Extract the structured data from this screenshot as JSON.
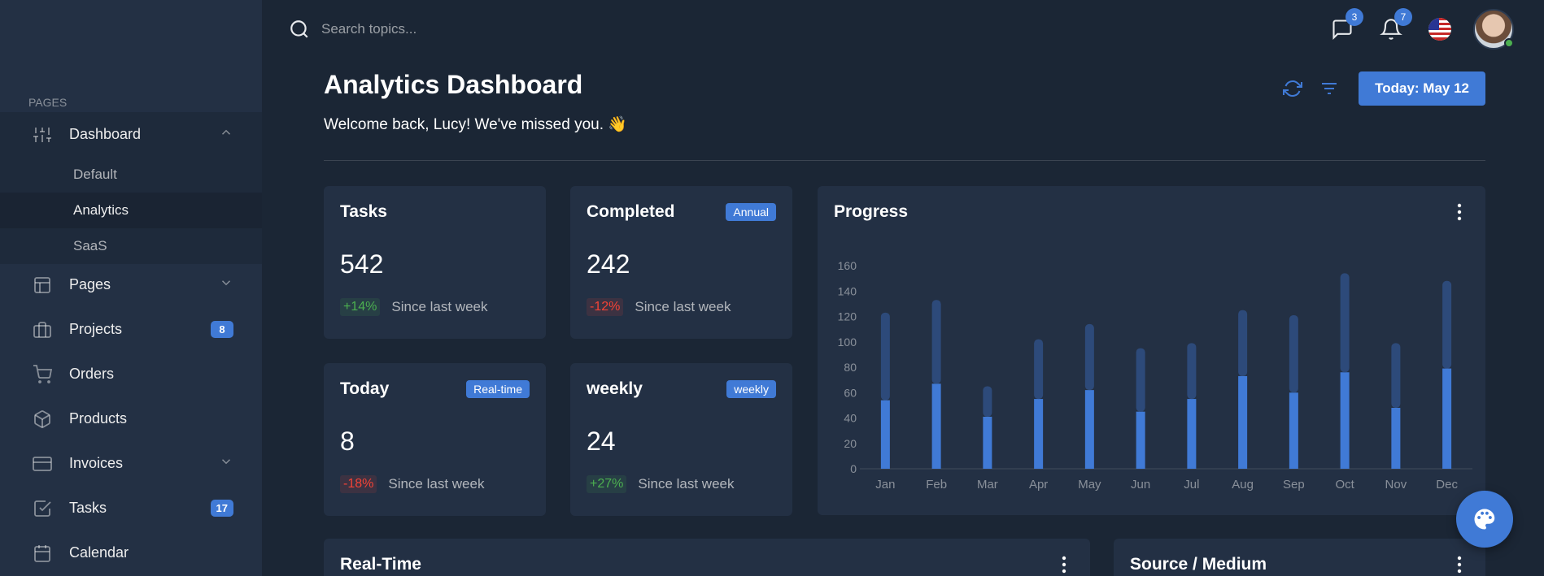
{
  "sidebar": {
    "section_title": "PAGES",
    "dashboard": {
      "label": "Dashboard",
      "icon": "sliders-icon"
    },
    "sub_items": [
      {
        "label": "Default",
        "active": false
      },
      {
        "label": "Analytics",
        "active": true
      },
      {
        "label": "SaaS",
        "active": false
      }
    ],
    "items": [
      {
        "label": "Pages",
        "icon": "layout-icon",
        "chevron": true,
        "badge": ""
      },
      {
        "label": "Projects",
        "icon": "briefcase-icon",
        "chevron": false,
        "badge": "8"
      },
      {
        "label": "Orders",
        "icon": "cart-icon",
        "chevron": false,
        "badge": ""
      },
      {
        "label": "Products",
        "icon": "package-icon",
        "chevron": false,
        "badge": ""
      },
      {
        "label": "Invoices",
        "icon": "card-icon",
        "chevron": true,
        "badge": ""
      },
      {
        "label": "Tasks",
        "icon": "checkbox-icon",
        "chevron": false,
        "badge": "17"
      },
      {
        "label": "Calendar",
        "icon": "calendar-icon",
        "chevron": false,
        "badge": ""
      }
    ]
  },
  "topbar": {
    "search_placeholder": "Search topics...",
    "messages_count": "3",
    "notifications_count": "7"
  },
  "header": {
    "title": "Analytics Dashboard",
    "welcome": "Welcome back, Lucy! We've missed you. 👋",
    "today_button": "Today: May 12"
  },
  "stats": [
    {
      "title": "Tasks",
      "chip": "",
      "value": "542",
      "delta": "+14%",
      "delta_dir": "up",
      "since": "Since last week"
    },
    {
      "title": "Completed",
      "chip": "Annual",
      "value": "242",
      "delta": "-12%",
      "delta_dir": "down",
      "since": "Since last week"
    },
    {
      "title": "Today",
      "chip": "Real-time",
      "value": "8",
      "delta": "-18%",
      "delta_dir": "down",
      "since": "Since last week"
    },
    {
      "title": "weekly",
      "chip": "weekly",
      "value": "24",
      "delta": "+27%",
      "delta_dir": "up",
      "since": "Since last week"
    }
  ],
  "progress": {
    "title": "Progress"
  },
  "bottom_cards": {
    "realtime_title": "Real-Time",
    "source_title": "Source / Medium"
  },
  "colors": {
    "accent": "#407ad6",
    "bar_light": "#407ad6",
    "bar_dark": "#2d4a7a",
    "sidebar": "#233044",
    "background": "#1b2635"
  },
  "chart_data": {
    "type": "bar",
    "stacked": true,
    "categories": [
      "Jan",
      "Feb",
      "Mar",
      "Apr",
      "May",
      "Jun",
      "Jul",
      "Aug",
      "Sep",
      "Oct",
      "Nov",
      "Dec"
    ],
    "series": [
      {
        "values": [
          54,
          67,
          41,
          55,
          62,
          45,
          55,
          73,
          60,
          76,
          48,
          79
        ]
      },
      {
        "values": [
          69,
          66,
          24,
          47,
          52,
          50,
          44,
          52,
          61,
          78,
          51,
          69
        ]
      }
    ],
    "ylim": [
      0,
      160
    ],
    "yticks": [
      0,
      20,
      40,
      60,
      80,
      100,
      120,
      140,
      160
    ],
    "grid": false
  }
}
